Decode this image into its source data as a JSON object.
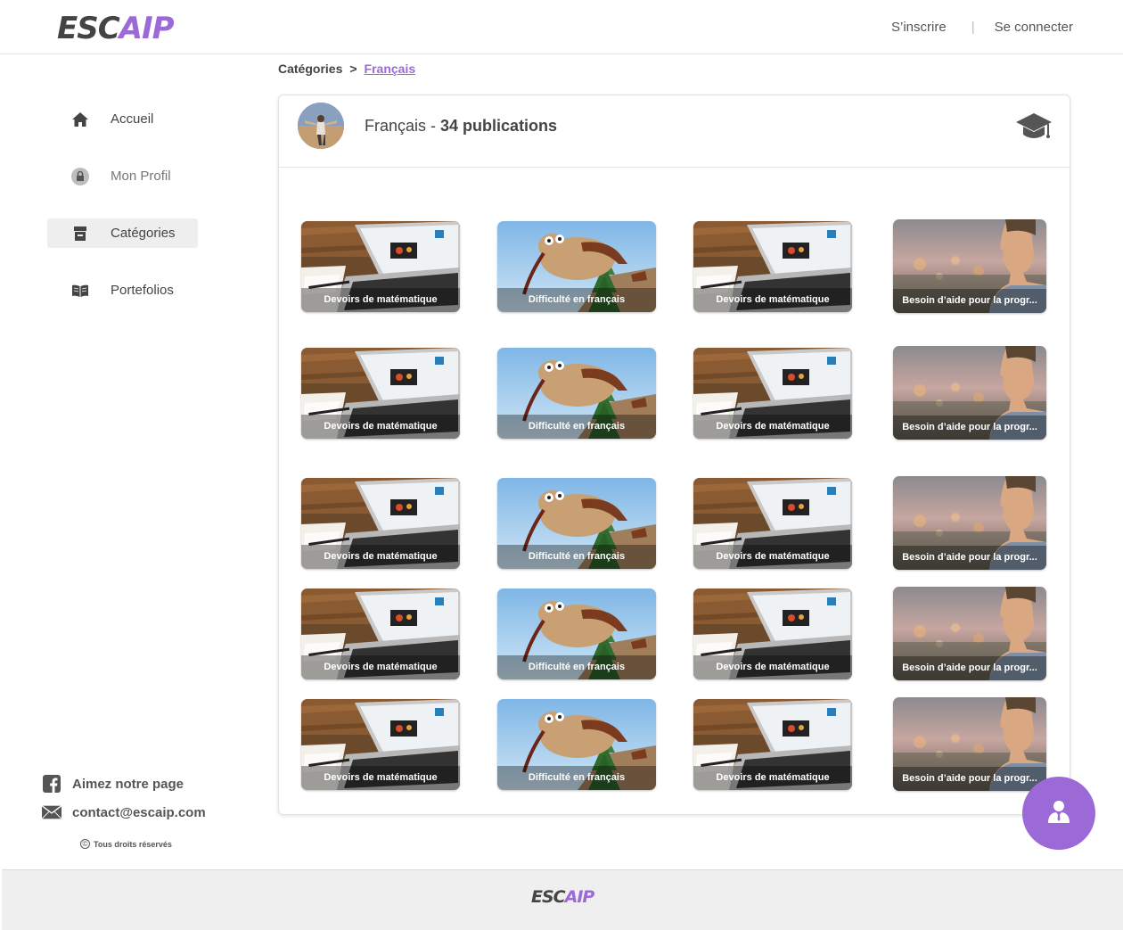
{
  "header": {
    "logo_part1": "ESC",
    "logo_part2": "AIP",
    "signup_label": "S’inscrire",
    "separator": "|",
    "login_label": "Se connecter"
  },
  "sidebar": {
    "items": [
      {
        "label": "Accueil",
        "icon": "home-icon"
      },
      {
        "label": "Mon Profil",
        "icon": "lock-icon"
      },
      {
        "label": "Catégories",
        "icon": "category-icon",
        "active": true
      },
      {
        "label": "Portefolios",
        "icon": "book-icon"
      }
    ],
    "like_label": "Aimez notre page",
    "contact_email": "contact@escaip.com",
    "copyright_symbol": "©",
    "copyright_text": "Tous droits réservés"
  },
  "breadcrumb": {
    "root": "Catégories",
    "separator": ">",
    "current": "Français"
  },
  "card": {
    "category_name": "Français",
    "dash": " - ",
    "count_text": "34 publications",
    "icon": "graduation-cap-icon"
  },
  "publications": [
    [
      "Devoirs de matématique",
      "Difficulté en français",
      "Devoirs de matématique",
      "Besoin d’aide pour la progr..."
    ],
    [
      "Devoirs de matématique",
      "Difficulté en français",
      "Devoirs de matématique",
      "Besoin d’aide pour la progr..."
    ],
    [
      "Devoirs de matématique",
      "Difficulté en français",
      "Devoirs de matématique",
      "Besoin d’aide pour la progr..."
    ],
    [
      "Devoirs de matématique",
      "Difficulté en français",
      "Devoirs de matématique",
      "Besoin d’aide pour la progr..."
    ],
    [
      "Devoirs de matématique",
      "Difficulté en français",
      "Devoirs de matématique",
      "Besoin d’aide pour la progr..."
    ]
  ],
  "fab": {
    "icon": "user-icon"
  },
  "footer": {
    "logo_part1": "ESC",
    "logo_part2": "AIP"
  },
  "colors": {
    "accent": "#9b6ad6",
    "text": "#444444",
    "footer_bg": "#efefef"
  }
}
